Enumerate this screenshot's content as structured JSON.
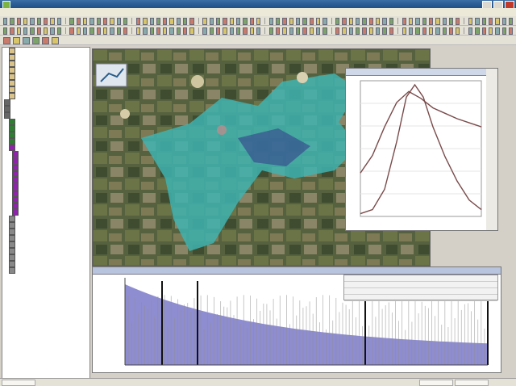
{
  "window": {
    "title": ""
  },
  "menubar": {
    "items": [
      "",
      "",
      "",
      "",
      "",
      "",
      ""
    ]
  },
  "sidebar": {
    "items": [
      {
        "color": "#d9c38a",
        "indent": 6
      },
      {
        "color": "#d9c38a",
        "indent": 6
      },
      {
        "color": "#d9c38a",
        "indent": 6
      },
      {
        "color": "#d9c38a",
        "indent": 6
      },
      {
        "color": "#d9c38a",
        "indent": 6
      },
      {
        "color": "#d9c38a",
        "indent": 6
      },
      {
        "color": "#d9c38a",
        "indent": 6
      },
      {
        "color": "#d9c38a",
        "indent": 6
      },
      {
        "color": "#666",
        "indent": 0
      },
      {
        "color": "#666",
        "indent": 0
      },
      {
        "color": "#666",
        "indent": 0
      },
      {
        "color": "#2e7d32",
        "indent": 6
      },
      {
        "color": "#2e7d32",
        "indent": 6
      },
      {
        "color": "#2e7d32",
        "indent": 6
      },
      {
        "color": "#2e7d32",
        "indent": 6
      },
      {
        "color": "#8e24aa",
        "indent": 6
      },
      {
        "color": "#8e24aa",
        "indent": 10
      },
      {
        "color": "#8e24aa",
        "indent": 10
      },
      {
        "color": "#8e24aa",
        "indent": 10
      },
      {
        "color": "#8e24aa",
        "indent": 10
      },
      {
        "color": "#8e24aa",
        "indent": 10
      },
      {
        "color": "#8e24aa",
        "indent": 10
      },
      {
        "color": "#8e24aa",
        "indent": 10
      },
      {
        "color": "#8e24aa",
        "indent": 10
      },
      {
        "color": "#8e24aa",
        "indent": 10
      },
      {
        "color": "#8e24aa",
        "indent": 10
      },
      {
        "color": "#888",
        "indent": 6
      },
      {
        "color": "#888",
        "indent": 6
      },
      {
        "color": "#888",
        "indent": 6
      },
      {
        "color": "#888",
        "indent": 6
      },
      {
        "color": "#888",
        "indent": 6
      },
      {
        "color": "#888",
        "indent": 6
      },
      {
        "color": "#888",
        "indent": 6
      },
      {
        "color": "#888",
        "indent": 6
      },
      {
        "color": "#888",
        "indent": 6
      }
    ]
  },
  "colors": {
    "map_bg": "#4b5a38",
    "flood_cyan": "#3fb3b0",
    "profile_line": "#7a4a4a",
    "area_fill": "#7b79c9",
    "bar_gray": "#8d8d8d"
  },
  "profile_chart": {
    "curve_a": [
      [
        0,
        0.02
      ],
      [
        0.1,
        0.05
      ],
      [
        0.2,
        0.2
      ],
      [
        0.3,
        0.55
      ],
      [
        0.38,
        0.88
      ],
      [
        0.45,
        0.97
      ],
      [
        0.52,
        0.88
      ],
      [
        0.6,
        0.66
      ],
      [
        0.7,
        0.44
      ],
      [
        0.8,
        0.26
      ],
      [
        0.9,
        0.12
      ],
      [
        1,
        0.05
      ]
    ],
    "curve_b": [
      [
        0,
        0.32
      ],
      [
        0.1,
        0.45
      ],
      [
        0.2,
        0.66
      ],
      [
        0.3,
        0.84
      ],
      [
        0.4,
        0.92
      ],
      [
        0.5,
        0.87
      ],
      [
        0.6,
        0.8
      ],
      [
        0.7,
        0.76
      ],
      [
        0.8,
        0.72
      ],
      [
        0.9,
        0.69
      ],
      [
        1,
        0.66
      ]
    ]
  },
  "lower_chart": {
    "ticks_x": [
      "",
      "",
      "",
      "",
      "",
      "",
      "",
      "",
      "",
      "",
      "",
      "",
      "",
      "",
      "",
      "",
      "",
      "",
      "",
      "",
      ""
    ],
    "ticks_y": [
      "",
      "",
      "",
      "",
      "",
      "",
      "",
      "",
      ""
    ]
  }
}
